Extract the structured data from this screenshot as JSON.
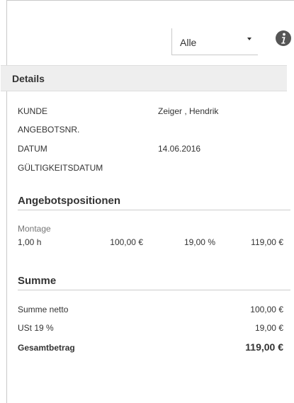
{
  "filter": {
    "value": "Alle"
  },
  "details": {
    "title": "Details",
    "rows": [
      {
        "label": "KUNDE",
        "value": "Zeiger , Hendrik"
      },
      {
        "label": "ANGEBOTSNR.",
        "value": ""
      },
      {
        "label": "DATUM",
        "value": "14.06.2016"
      },
      {
        "label": "GÜLTIGKEITSDATUM",
        "value": ""
      }
    ]
  },
  "positions": {
    "title": "Angebotspositionen",
    "items": [
      {
        "name": "Montage",
        "quantity": "1,00 h",
        "unit_price": "100,00 €",
        "tax": "19,00 %",
        "total": "119,00 €"
      }
    ]
  },
  "summary": {
    "title": "Summe",
    "net_label": "Summe netto",
    "net_value": "100,00 €",
    "tax_label": "USt 19 %",
    "tax_value": "19,00 €",
    "gross_label": "Gesamtbetrag",
    "gross_value": "119,00 €"
  },
  "icons": {
    "info": "info-icon",
    "dropdown": "chevron-down-icon"
  }
}
